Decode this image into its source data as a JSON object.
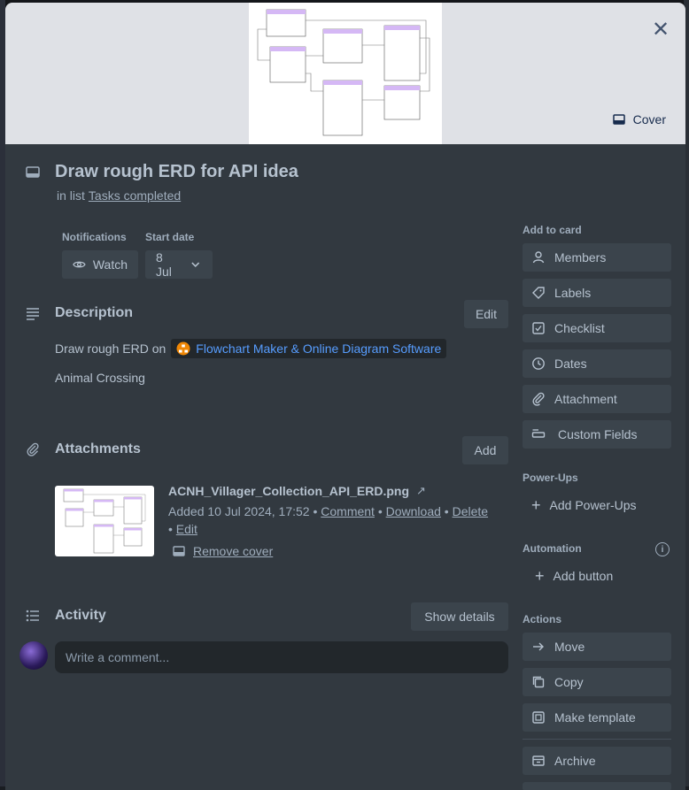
{
  "card": {
    "title": "Draw rough ERD for API idea",
    "in_list_prefix": "in list",
    "list_name": "Tasks completed",
    "cover_label": "Cover"
  },
  "meta": {
    "notifications_label": "Notifications",
    "watch_label": "Watch",
    "start_date_label": "Start date",
    "start_date_value": "8 Jul"
  },
  "description": {
    "heading": "Description",
    "edit_label": "Edit",
    "text_prefix": "Draw rough ERD on",
    "link_text": "Flowchart Maker & Online Diagram Software",
    "line2": "Animal Crossing"
  },
  "attachments": {
    "heading": "Attachments",
    "add_label": "Add",
    "items": [
      {
        "filename": "ACNH_Villager_Collection_API_ERD.png",
        "added": "Added 10 Jul 2024, 17:52",
        "actions": [
          "Comment",
          "Download",
          "Delete",
          "Edit"
        ],
        "remove_cover": "Remove cover"
      }
    ]
  },
  "activity": {
    "heading": "Activity",
    "show_details": "Show details",
    "comment_placeholder": "Write a comment..."
  },
  "sidebar": {
    "add_to_card_label": "Add to card",
    "add_to_card": [
      {
        "label": "Members",
        "icon": "person-icon"
      },
      {
        "label": "Labels",
        "icon": "tag-icon"
      },
      {
        "label": "Checklist",
        "icon": "checkbox-icon"
      },
      {
        "label": "Dates",
        "icon": "clock-icon"
      },
      {
        "label": "Attachment",
        "icon": "paperclip-icon"
      },
      {
        "label": "Custom Fields",
        "icon": "field-icon"
      }
    ],
    "powerups_label": "Power-Ups",
    "add_powerups": "Add Power-Ups",
    "automation_label": "Automation",
    "add_button": "Add button",
    "actions_label": "Actions",
    "actions": [
      {
        "label": "Move",
        "icon": "arrow-right-icon"
      },
      {
        "label": "Copy",
        "icon": "copy-icon"
      },
      {
        "label": "Make template",
        "icon": "template-icon"
      },
      {
        "label": "Archive",
        "icon": "archive-icon"
      }
    ]
  },
  "colors": {
    "modal_bg": "#323940",
    "button_bg": "#3b444c",
    "link_blue": "#579dff",
    "text": "#b6c2cf"
  }
}
